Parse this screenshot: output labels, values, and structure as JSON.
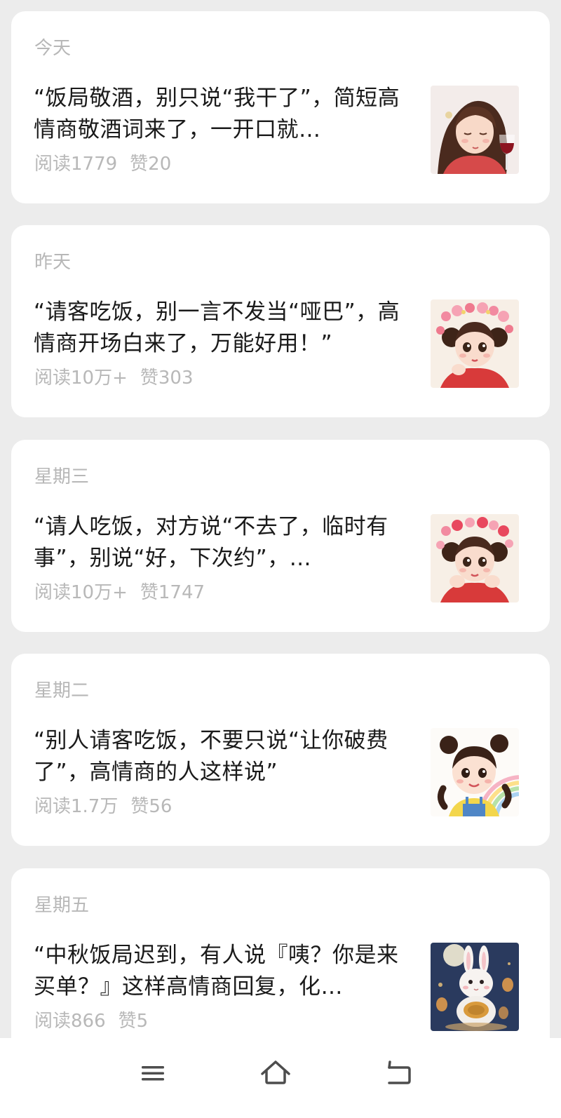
{
  "articles": [
    {
      "day": "今天",
      "title": "“饭局敬酒，别只说“我干了”，简短高情商敬酒词来了，一开口就…",
      "reads": "阅读1779",
      "likes": "赞20",
      "thumb": "girl-with-wine-glass"
    },
    {
      "day": "昨天",
      "title": "“请客吃饭，别一言不发当“哑巴”，高情商开场白来了，万能好用！”",
      "reads": "阅读10万+",
      "likes": "赞303",
      "thumb": "girl-with-flower-crown"
    },
    {
      "day": "星期三",
      "title": "“请人吃饭，对方说“不去了，临时有事”，别说“好，下次约”，…",
      "reads": "阅读10万+",
      "likes": "赞1747",
      "thumb": "girl-with-flower-crown"
    },
    {
      "day": "星期二",
      "title": "“别人请客吃饭，不要只说“让你破费了”，高情商的人这样说”",
      "reads": "阅读1.7万",
      "likes": "赞56",
      "thumb": "girl-with-rainbow"
    },
    {
      "day": "星期五",
      "title": "“中秋饭局迟到，有人说『咦？你是来买单？』这样高情商回复，化…",
      "reads": "阅读866",
      "likes": "赞5",
      "thumb": "rabbit-with-mooncake"
    }
  ],
  "navbar": {
    "menu_icon": "menu-icon",
    "home_icon": "home-icon",
    "back_icon": "back-icon"
  },
  "colors": {
    "page_background": "#ececec",
    "card_background": "#ffffff",
    "title_text": "#1a1a1a",
    "secondary_text": "#b8b8b8"
  }
}
